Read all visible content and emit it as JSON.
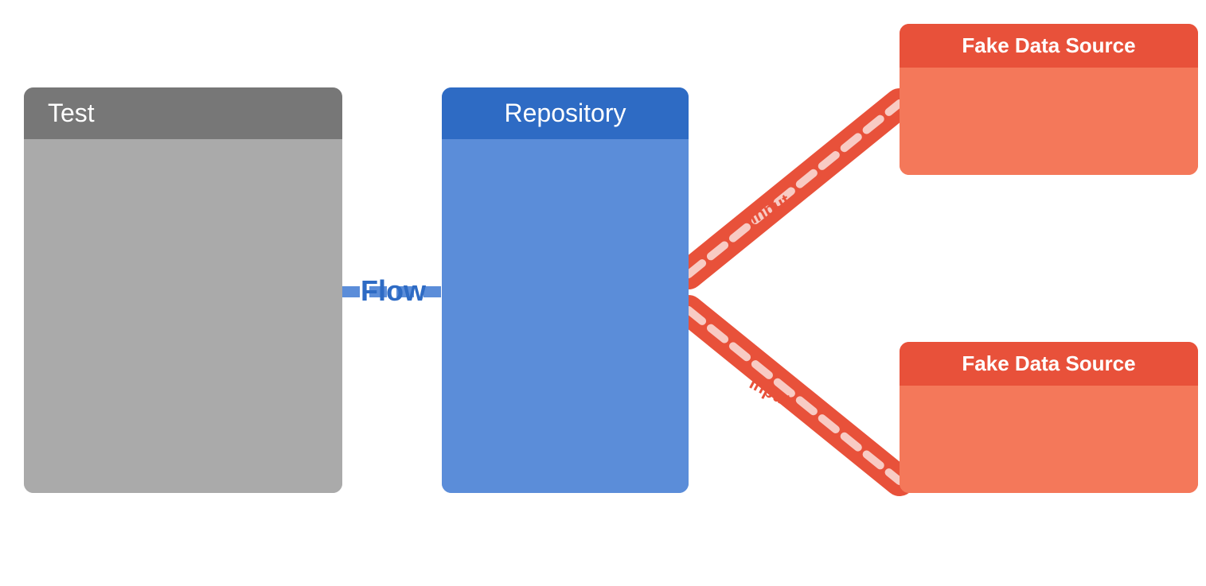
{
  "test_block": {
    "header_label": "Test"
  },
  "repo_block": {
    "header_label": "Repository"
  },
  "fds_top": {
    "header_label": "Fake Data Source"
  },
  "fds_bottom": {
    "header_label": "Fake Data Source"
  },
  "flow_label": "Flow",
  "input_top_label": "Input",
  "input_bottom_label": "Input",
  "colors": {
    "blue_dark": "#2e6bc4",
    "blue_mid": "#5b8dd9",
    "orange_dark": "#e8513a",
    "orange_mid": "#f4785a",
    "gray_dark": "#777777",
    "gray_mid": "#aaaaaa"
  }
}
